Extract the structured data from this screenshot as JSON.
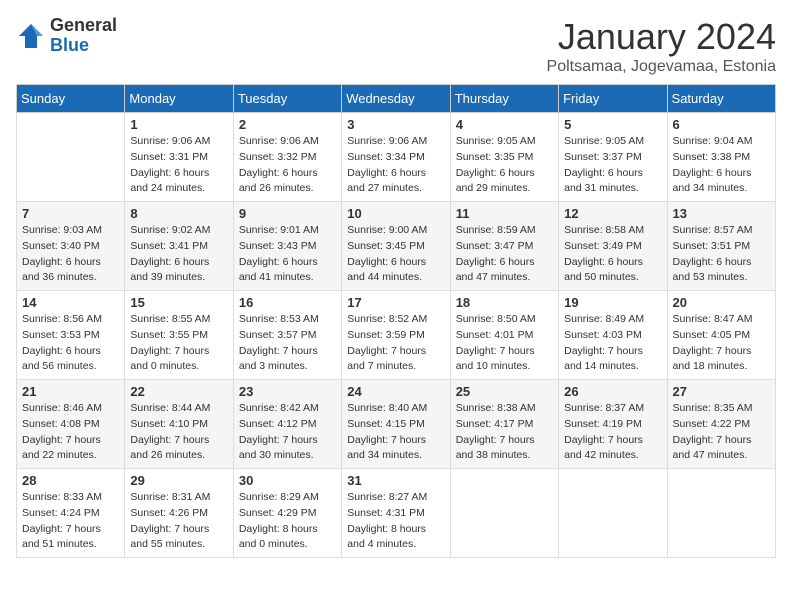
{
  "logo": {
    "general": "General",
    "blue": "Blue"
  },
  "header": {
    "month": "January 2024",
    "location": "Poltsamaa, Jogevamaa, Estonia"
  },
  "weekdays": [
    "Sunday",
    "Monday",
    "Tuesday",
    "Wednesday",
    "Thursday",
    "Friday",
    "Saturday"
  ],
  "weeks": [
    [
      {
        "day": "",
        "sunrise": "",
        "sunset": "",
        "daylight": ""
      },
      {
        "day": "1",
        "sunrise": "Sunrise: 9:06 AM",
        "sunset": "Sunset: 3:31 PM",
        "daylight": "Daylight: 6 hours and 24 minutes."
      },
      {
        "day": "2",
        "sunrise": "Sunrise: 9:06 AM",
        "sunset": "Sunset: 3:32 PM",
        "daylight": "Daylight: 6 hours and 26 minutes."
      },
      {
        "day": "3",
        "sunrise": "Sunrise: 9:06 AM",
        "sunset": "Sunset: 3:34 PM",
        "daylight": "Daylight: 6 hours and 27 minutes."
      },
      {
        "day": "4",
        "sunrise": "Sunrise: 9:05 AM",
        "sunset": "Sunset: 3:35 PM",
        "daylight": "Daylight: 6 hours and 29 minutes."
      },
      {
        "day": "5",
        "sunrise": "Sunrise: 9:05 AM",
        "sunset": "Sunset: 3:37 PM",
        "daylight": "Daylight: 6 hours and 31 minutes."
      },
      {
        "day": "6",
        "sunrise": "Sunrise: 9:04 AM",
        "sunset": "Sunset: 3:38 PM",
        "daylight": "Daylight: 6 hours and 34 minutes."
      }
    ],
    [
      {
        "day": "7",
        "sunrise": "Sunrise: 9:03 AM",
        "sunset": "Sunset: 3:40 PM",
        "daylight": "Daylight: 6 hours and 36 minutes."
      },
      {
        "day": "8",
        "sunrise": "Sunrise: 9:02 AM",
        "sunset": "Sunset: 3:41 PM",
        "daylight": "Daylight: 6 hours and 39 minutes."
      },
      {
        "day": "9",
        "sunrise": "Sunrise: 9:01 AM",
        "sunset": "Sunset: 3:43 PM",
        "daylight": "Daylight: 6 hours and 41 minutes."
      },
      {
        "day": "10",
        "sunrise": "Sunrise: 9:00 AM",
        "sunset": "Sunset: 3:45 PM",
        "daylight": "Daylight: 6 hours and 44 minutes."
      },
      {
        "day": "11",
        "sunrise": "Sunrise: 8:59 AM",
        "sunset": "Sunset: 3:47 PM",
        "daylight": "Daylight: 6 hours and 47 minutes."
      },
      {
        "day": "12",
        "sunrise": "Sunrise: 8:58 AM",
        "sunset": "Sunset: 3:49 PM",
        "daylight": "Daylight: 6 hours and 50 minutes."
      },
      {
        "day": "13",
        "sunrise": "Sunrise: 8:57 AM",
        "sunset": "Sunset: 3:51 PM",
        "daylight": "Daylight: 6 hours and 53 minutes."
      }
    ],
    [
      {
        "day": "14",
        "sunrise": "Sunrise: 8:56 AM",
        "sunset": "Sunset: 3:53 PM",
        "daylight": "Daylight: 6 hours and 56 minutes."
      },
      {
        "day": "15",
        "sunrise": "Sunrise: 8:55 AM",
        "sunset": "Sunset: 3:55 PM",
        "daylight": "Daylight: 7 hours and 0 minutes."
      },
      {
        "day": "16",
        "sunrise": "Sunrise: 8:53 AM",
        "sunset": "Sunset: 3:57 PM",
        "daylight": "Daylight: 7 hours and 3 minutes."
      },
      {
        "day": "17",
        "sunrise": "Sunrise: 8:52 AM",
        "sunset": "Sunset: 3:59 PM",
        "daylight": "Daylight: 7 hours and 7 minutes."
      },
      {
        "day": "18",
        "sunrise": "Sunrise: 8:50 AM",
        "sunset": "Sunset: 4:01 PM",
        "daylight": "Daylight: 7 hours and 10 minutes."
      },
      {
        "day": "19",
        "sunrise": "Sunrise: 8:49 AM",
        "sunset": "Sunset: 4:03 PM",
        "daylight": "Daylight: 7 hours and 14 minutes."
      },
      {
        "day": "20",
        "sunrise": "Sunrise: 8:47 AM",
        "sunset": "Sunset: 4:05 PM",
        "daylight": "Daylight: 7 hours and 18 minutes."
      }
    ],
    [
      {
        "day": "21",
        "sunrise": "Sunrise: 8:46 AM",
        "sunset": "Sunset: 4:08 PM",
        "daylight": "Daylight: 7 hours and 22 minutes."
      },
      {
        "day": "22",
        "sunrise": "Sunrise: 8:44 AM",
        "sunset": "Sunset: 4:10 PM",
        "daylight": "Daylight: 7 hours and 26 minutes."
      },
      {
        "day": "23",
        "sunrise": "Sunrise: 8:42 AM",
        "sunset": "Sunset: 4:12 PM",
        "daylight": "Daylight: 7 hours and 30 minutes."
      },
      {
        "day": "24",
        "sunrise": "Sunrise: 8:40 AM",
        "sunset": "Sunset: 4:15 PM",
        "daylight": "Daylight: 7 hours and 34 minutes."
      },
      {
        "day": "25",
        "sunrise": "Sunrise: 8:38 AM",
        "sunset": "Sunset: 4:17 PM",
        "daylight": "Daylight: 7 hours and 38 minutes."
      },
      {
        "day": "26",
        "sunrise": "Sunrise: 8:37 AM",
        "sunset": "Sunset: 4:19 PM",
        "daylight": "Daylight: 7 hours and 42 minutes."
      },
      {
        "day": "27",
        "sunrise": "Sunrise: 8:35 AM",
        "sunset": "Sunset: 4:22 PM",
        "daylight": "Daylight: 7 hours and 47 minutes."
      }
    ],
    [
      {
        "day": "28",
        "sunrise": "Sunrise: 8:33 AM",
        "sunset": "Sunset: 4:24 PM",
        "daylight": "Daylight: 7 hours and 51 minutes."
      },
      {
        "day": "29",
        "sunrise": "Sunrise: 8:31 AM",
        "sunset": "Sunset: 4:26 PM",
        "daylight": "Daylight: 7 hours and 55 minutes."
      },
      {
        "day": "30",
        "sunrise": "Sunrise: 8:29 AM",
        "sunset": "Sunset: 4:29 PM",
        "daylight": "Daylight: 8 hours and 0 minutes."
      },
      {
        "day": "31",
        "sunrise": "Sunrise: 8:27 AM",
        "sunset": "Sunset: 4:31 PM",
        "daylight": "Daylight: 8 hours and 4 minutes."
      },
      {
        "day": "",
        "sunrise": "",
        "sunset": "",
        "daylight": ""
      },
      {
        "day": "",
        "sunrise": "",
        "sunset": "",
        "daylight": ""
      },
      {
        "day": "",
        "sunrise": "",
        "sunset": "",
        "daylight": ""
      }
    ]
  ]
}
